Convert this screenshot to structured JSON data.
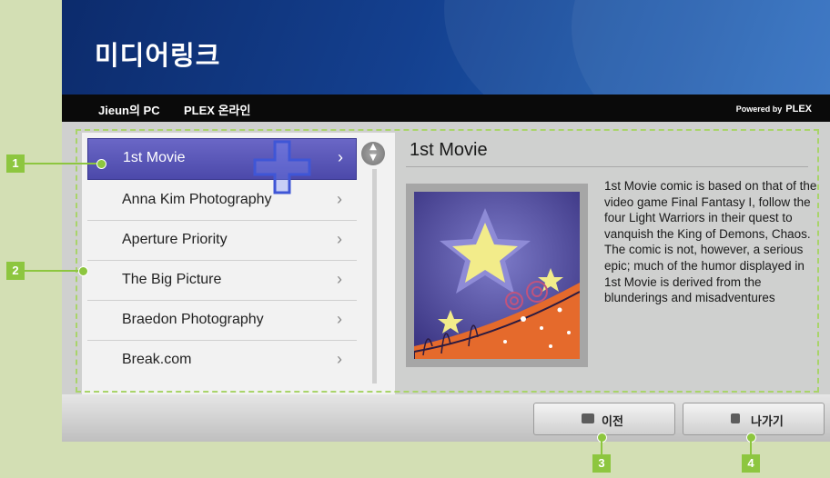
{
  "app": {
    "title": "미디어링크"
  },
  "info_bar": {
    "server_name": "Jieun의 PC",
    "service_name": "PLEX 온라인",
    "powered_by": "Powered by",
    "powered_brand": "PLEX"
  },
  "list": {
    "items": [
      {
        "label": "1st Movie",
        "selected": true
      },
      {
        "label": "Anna Kim Photography",
        "selected": false
      },
      {
        "label": "Aperture Priority",
        "selected": false
      },
      {
        "label": "The Big Picture",
        "selected": false
      },
      {
        "label": "Braedon Photography",
        "selected": false
      },
      {
        "label": "Break.com",
        "selected": false
      }
    ],
    "chevron": "›",
    "scroll_icon": "chevron-up-down-icon"
  },
  "detail": {
    "title": "1st Movie",
    "description": "1st Movie comic is based on that of the video game Final Fantasy I, follow the four Light Warriors in their quest to vanquish the King of Demons, Chaos. The comic is not, however, a serious epic; much of the humor displayed in 1st Movie is derived from the blunderings and misadventures"
  },
  "footer": {
    "back_label": "이전",
    "back_icon": "back-remote-icon",
    "exit_label": "나가기",
    "exit_icon": "exit-remote-icon"
  },
  "callouts": {
    "c1": "1",
    "c2": "2",
    "c3": "3",
    "c4": "4"
  },
  "colors": {
    "accent_green": "#8dc63f",
    "selection_purple": "#5a57b8",
    "header_blue": "#14408f"
  }
}
